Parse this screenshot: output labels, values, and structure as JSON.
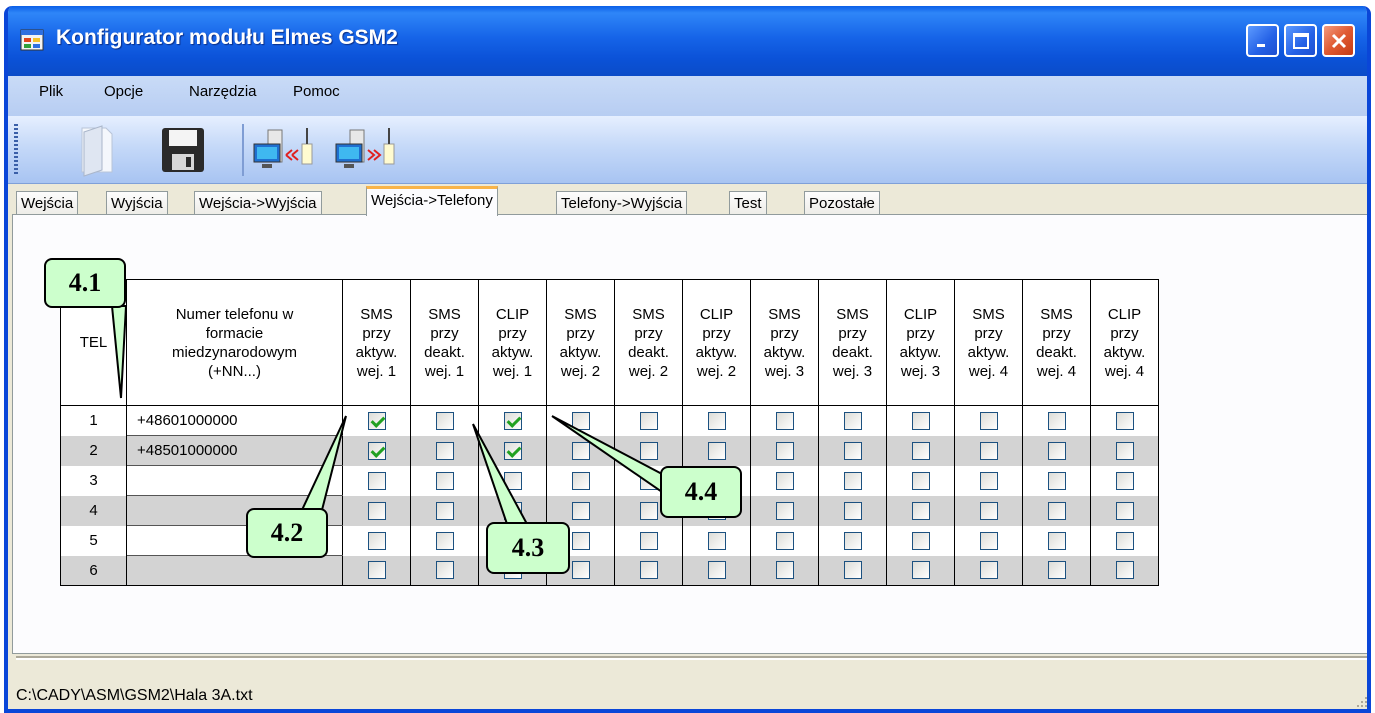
{
  "window": {
    "title": "Konfigurator modułu Elmes GSM2",
    "controls": [
      "minimize-icon",
      "maximize-icon",
      "close-icon"
    ]
  },
  "menu": [
    "Plik",
    "Opcje",
    "Narzędzia",
    "Pomoc"
  ],
  "toolbar": {
    "buttons": [
      "open-file-icon",
      "save-icon",
      "read-from-module-icon",
      "write-to-module-icon"
    ]
  },
  "tabs": {
    "items": [
      "Wejścia",
      "Wyjścia",
      "Wejścia->Wyjścia",
      "Wejścia->Telefony",
      "Telefony->Wyjścia",
      "Test",
      "Pozostałe"
    ],
    "active": "Wejścia->Telefony"
  },
  "table": {
    "tel_header": "TEL",
    "phone_header": [
      "Numer telefonu w",
      "formacie",
      "miedzynarodowym",
      "(+NN...)"
    ],
    "columns": [
      [
        "SMS",
        "przy",
        "aktyw.",
        "wej. 1"
      ],
      [
        "SMS",
        "przy",
        "deakt.",
        "wej. 1"
      ],
      [
        "CLIP",
        "przy",
        "aktyw.",
        "wej. 1"
      ],
      [
        "SMS",
        "przy",
        "aktyw.",
        "wej. 2"
      ],
      [
        "SMS",
        "przy",
        "deakt.",
        "wej. 2"
      ],
      [
        "CLIP",
        "przy",
        "aktyw.",
        "wej. 2"
      ],
      [
        "SMS",
        "przy",
        "aktyw.",
        "wej. 3"
      ],
      [
        "SMS",
        "przy",
        "deakt.",
        "wej. 3"
      ],
      [
        "CLIP",
        "przy",
        "aktyw.",
        "wej. 3"
      ],
      [
        "SMS",
        "przy",
        "aktyw.",
        "wej. 4"
      ],
      [
        "SMS",
        "przy",
        "deakt.",
        "wej. 4"
      ],
      [
        "CLIP",
        "przy",
        "aktyw.",
        "wej. 4"
      ]
    ],
    "rows": [
      {
        "num": "1",
        "phone": "+48601000000",
        "checks": [
          true,
          false,
          true,
          false,
          false,
          false,
          false,
          false,
          false,
          false,
          false,
          false
        ]
      },
      {
        "num": "2",
        "phone": "+48501000000",
        "checks": [
          true,
          false,
          true,
          false,
          false,
          false,
          false,
          false,
          false,
          false,
          false,
          false
        ]
      },
      {
        "num": "3",
        "phone": "",
        "checks": [
          false,
          false,
          false,
          false,
          false,
          false,
          false,
          false,
          false,
          false,
          false,
          false
        ]
      },
      {
        "num": "4",
        "phone": "",
        "checks": [
          false,
          false,
          false,
          false,
          false,
          false,
          false,
          false,
          false,
          false,
          false,
          false
        ]
      },
      {
        "num": "5",
        "phone": "",
        "checks": [
          false,
          false,
          false,
          false,
          false,
          false,
          false,
          false,
          false,
          false,
          false,
          false
        ]
      },
      {
        "num": "6",
        "phone": "",
        "checks": [
          false,
          false,
          false,
          false,
          false,
          false,
          false,
          false,
          false,
          false,
          false,
          false
        ]
      }
    ]
  },
  "callouts": [
    "4.1",
    "4.2",
    "4.3",
    "4.4"
  ],
  "status": {
    "path": "C:\\CADY\\ASM\\GSM2\\Hala 3A.txt"
  }
}
